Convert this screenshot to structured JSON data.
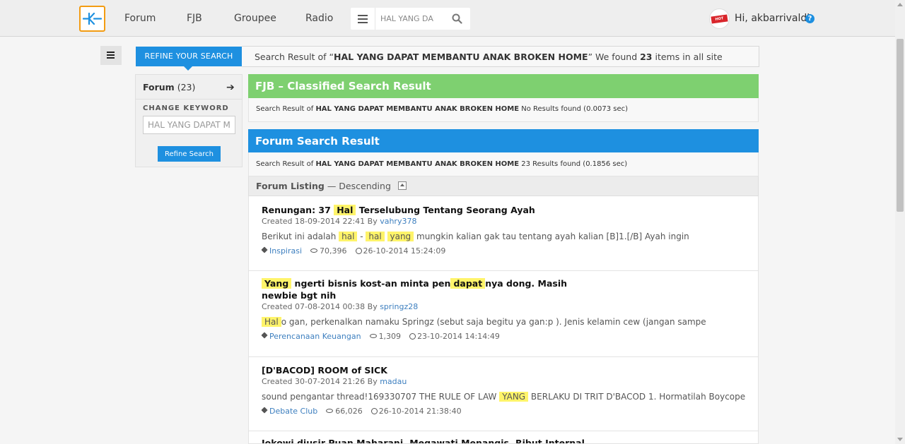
{
  "nav": {
    "links": [
      "Forum",
      "FJB",
      "Groupee",
      "Radio"
    ],
    "search_placeholder": "HAL YANG DAPAT MEMBANTU ANAK BROKEN HOME",
    "greeting": "Hi, akbarrivaldi",
    "help": "?",
    "avatar_text": "HOT NEWS"
  },
  "header": {
    "refine_tab": "REFINE YOUR SEARCH",
    "summary_prefix": "Search Result of “",
    "query": "HAL YANG DAPAT MEMBANTU ANAK BROKEN HOME",
    "summary_mid": "” We found ",
    "count": "23",
    "summary_suffix": " items in all site"
  },
  "sidebar": {
    "forum_label": "Forum",
    "forum_count": "(23)",
    "arrow": "➔",
    "change_keyword": "CHANGE KEYWORD",
    "keyword_value": "HAL YANG DAPAT MEMBANTU ANAK BROKEN HOME",
    "refine_button": "Refine Search"
  },
  "fjb": {
    "title": "FJB – Classified Search Result",
    "info_prefix": "Search Result of ",
    "info_query": "HAL YANG DAPAT MEMBANTU ANAK BROKEN HOME",
    "info_suffix": "  No Results found (0.0073 sec)"
  },
  "forum": {
    "title": "Forum Search Result",
    "info_prefix": "Search Result of ",
    "info_query": "HAL YANG DAPAT MEMBANTU ANAK BROKEN HOME",
    "info_suffix": " 23 Results found (0.1856 sec)",
    "listing_label": "Forum Listing",
    "listing_sort": " — Descending"
  },
  "results": [
    {
      "title_parts": [
        "Renungan: 37 ",
        "Hal",
        " Terselubung Tentang Seorang Ayah"
      ],
      "created": "Created 18-09-2014 22:41 By ",
      "author": "vahry378",
      "snippet_parts": [
        "Berikut ini adalah ",
        "hal",
        " - ",
        "hal",
        " ",
        "yang",
        " mungkin kalian gak tau tentang ayah kalian [B]1.[/B] Ayah ingin"
      ],
      "category": "Inspirasi",
      "views": "70,396",
      "last": "26-10-2014 15:24:09"
    },
    {
      "title_parts": [
        "Yang",
        " ngerti bisnis kost-an minta pen",
        "dapat",
        "nya dong. Masih",
        "newbie bgt nih"
      ],
      "created": "Created 07-08-2014 00:38 By ",
      "author": "springz28",
      "snippet_parts": [
        "Hal",
        "o gan, perkenalkan namaku Springz (sebut saja begitu ya gan:p ). Jenis kelamin cew (jangan sampe"
      ],
      "category": "Perencanaan Keuangan",
      "views": "1,309",
      "last": "23-10-2014 14:14:49"
    },
    {
      "title_parts": [
        "[D'BACOD] ROOM of SICK"
      ],
      "created": "Created 30-07-2014 21:26 By ",
      "author": "madau",
      "snippet_parts": [
        "sound pengantar thread!169330707 THE RULE OF LAW ",
        "YANG",
        " BERLAKU DI TRIT D'BACOD 1. Hormatilah Boycope"
      ],
      "category": "Debate Club",
      "views": "66,026",
      "last": "26-10-2014 21:38:40"
    },
    {
      "title_parts": [
        "Jokowi diusir Puan Maharani, Megawati Menangis, Ribut Internal"
      ]
    }
  ]
}
